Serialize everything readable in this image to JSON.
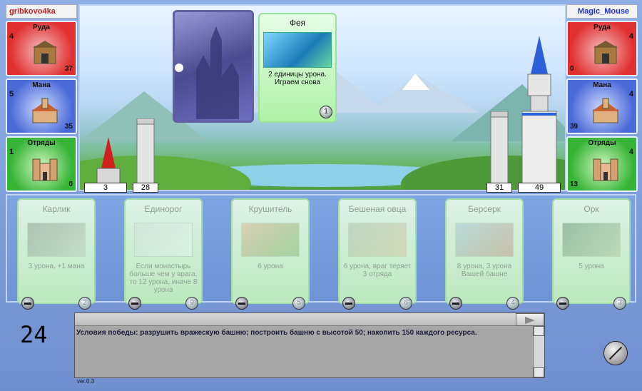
{
  "left_player": {
    "name": "gribkovo4ka",
    "resources": [
      {
        "title": "Руда",
        "production": "4",
        "amount": "37"
      },
      {
        "title": "Мана",
        "production": "5",
        "amount": "35"
      },
      {
        "title": "Отряды",
        "production": "1",
        "amount": "0"
      }
    ],
    "tower": "3",
    "wall": "28"
  },
  "right_player": {
    "name": "Magic_Mouse",
    "resources": [
      {
        "title": "Руда",
        "production": "4",
        "amount": "0"
      },
      {
        "title": "Мана",
        "production": "4",
        "amount": "39"
      },
      {
        "title": "Отряды",
        "production": "4",
        "amount": "13"
      }
    ],
    "wall": "31",
    "tower": "49"
  },
  "played_card": {
    "title": "Фея",
    "description": "2 единицы урона. Играем снова",
    "cost": "1"
  },
  "hand": [
    {
      "title": "Карлик",
      "description": "3 урона, +1 мана",
      "cost": "2"
    },
    {
      "title": "Единорог",
      "description": "Если монастырь больше чем у врага, то 12 урона, иначе 8 урона",
      "cost": "9"
    },
    {
      "title": "Крушитель",
      "description": "6 урона",
      "cost": "5"
    },
    {
      "title": "Бешеная овца",
      "description": "6 урона, враг теряет 3 отряда",
      "cost": "6"
    },
    {
      "title": "Берсерк",
      "description": "8 урона, 3 урона Вашей башне",
      "cost": "4"
    },
    {
      "title": "Орк",
      "description": "5 урона",
      "cost": "3"
    }
  ],
  "timer": "24",
  "log": {
    "message": "Условия победы: разрушить вражескую башню; построить башню с высотой 50; накопить 150 каждого ресурса."
  },
  "version": "ver.0.3",
  "colors": {
    "ore": "#e03030",
    "mana": "#4a6ad8",
    "troops": "#36b436",
    "card": "#c4f2bc"
  }
}
